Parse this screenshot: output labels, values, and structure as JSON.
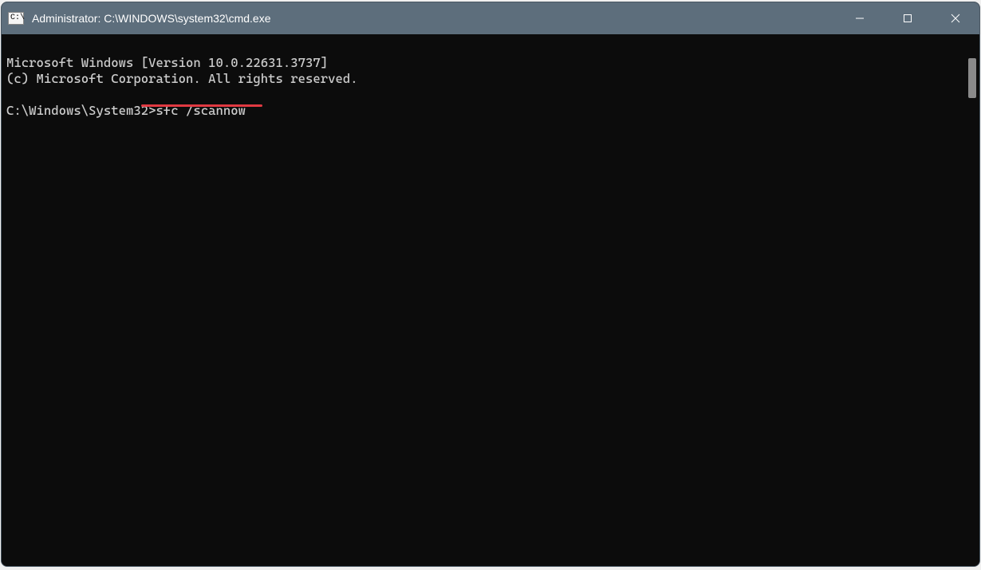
{
  "titlebar": {
    "title": "Administrator: C:\\WINDOWS\\system32\\cmd.exe",
    "icon_label": "C:\\"
  },
  "terminal": {
    "line1": "Microsoft Windows [Version 10.0.22631.3737]",
    "line2": "(c) Microsoft Corporation. All rights reserved.",
    "blank": "",
    "prompt": "C:\\Windows\\System32>",
    "command": "sfc /scannow"
  },
  "annotation": {
    "underline_color": "#e13a42"
  }
}
